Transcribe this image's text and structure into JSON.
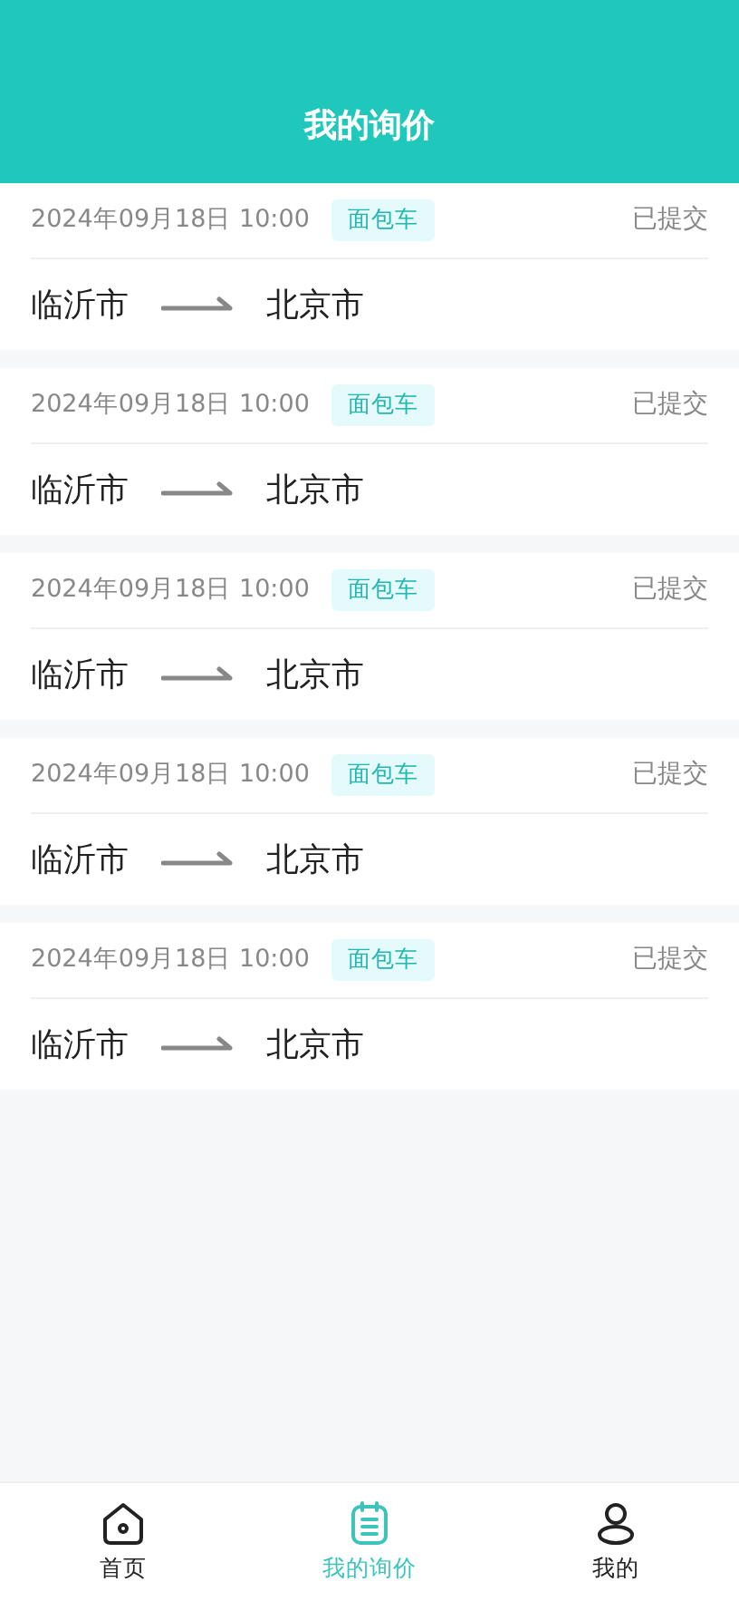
{
  "header": {
    "title": "我的询价"
  },
  "inquiries": [
    {
      "time": "2024年09月18日 10:00",
      "vehicle": "面包车",
      "status": "已提交",
      "from": "临沂市",
      "to": "北京市"
    },
    {
      "time": "2024年09月18日 10:00",
      "vehicle": "面包车",
      "status": "已提交",
      "from": "临沂市",
      "to": "北京市"
    },
    {
      "time": "2024年09月18日 10:00",
      "vehicle": "面包车",
      "status": "已提交",
      "from": "临沂市",
      "to": "北京市"
    },
    {
      "time": "2024年09月18日 10:00",
      "vehicle": "面包车",
      "status": "已提交",
      "from": "临沂市",
      "to": "北京市"
    },
    {
      "time": "2024年09月18日 10:00",
      "vehicle": "面包车",
      "status": "已提交",
      "from": "临沂市",
      "to": "北京市"
    }
  ],
  "tab_bar": [
    {
      "kind": "home",
      "label": "首页",
      "selected": false
    },
    {
      "kind": "inquiry",
      "label": "我的询价",
      "selected": true
    },
    {
      "kind": "profile",
      "label": "我的",
      "selected": false
    }
  ]
}
